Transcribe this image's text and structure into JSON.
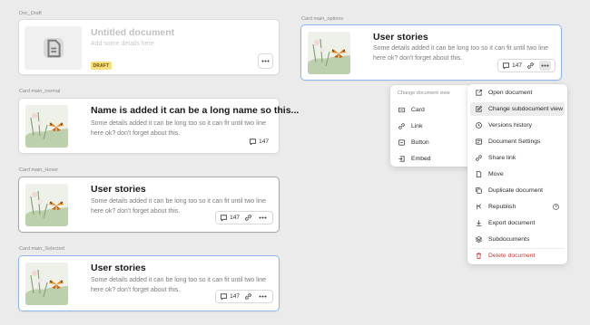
{
  "frames": {
    "doc_draft": "Doc_Draft",
    "card_main_normal": "Card main_normal",
    "card_main_hover": "Card main_Hover",
    "card_main_selected": "Card main_Selected",
    "card_main_options": "Card main_options"
  },
  "draft_card": {
    "title": "Untitled document",
    "description": "Add some details here",
    "badge": "DRAFT"
  },
  "normal_card": {
    "title": "Name is added it can be a long name so this...",
    "description": "Some details added it can be long too so it can fit until two line here ok? don't forget about this.",
    "comment_count": "147"
  },
  "hover_card": {
    "title": "User stories",
    "description": "Some details added it can be long too so it can fit until two line here ok? don't forget about this.",
    "comment_count": "147"
  },
  "selected_card": {
    "title": "User stories",
    "description": "Some details added it can be long too so it can fit until two line here ok? don't forget about this.",
    "comment_count": "147"
  },
  "options_card": {
    "title": "User stories",
    "description": "Some details added it can be long too so it can fit until two line here ok? don't forget about this.",
    "comment_count": "147"
  },
  "submenu": {
    "title": "Change document view",
    "items": [
      {
        "label": "Card",
        "icon": "card-icon"
      },
      {
        "label": "Link",
        "icon": "link-icon"
      },
      {
        "label": "Button",
        "icon": "button-icon"
      },
      {
        "label": "Embed",
        "icon": "embed-icon"
      }
    ]
  },
  "context_menu": {
    "items": [
      {
        "label": "Open document",
        "icon": "open-external-icon"
      },
      {
        "label": "Change subdocument view",
        "icon": "edit-icon",
        "highlighted": true
      },
      {
        "label": "Versions history",
        "icon": "history-icon"
      },
      {
        "label": "Document Settings",
        "icon": "settings-icon"
      },
      {
        "label": "Share link",
        "icon": "link-icon"
      },
      {
        "label": "Move",
        "icon": "move-icon"
      },
      {
        "label": "Duplicate document",
        "icon": "duplicate-icon"
      },
      {
        "label": "Republish",
        "icon": "republish-icon",
        "trailing_icon": "help-circle-icon"
      },
      {
        "label": "Export document",
        "icon": "download-icon"
      },
      {
        "label": "Subdocuments",
        "icon": "layers-icon"
      },
      {
        "label": "Delete document",
        "icon": "trash-icon",
        "danger": true
      }
    ]
  },
  "colors": {
    "selected_border": "#8fb7ef",
    "draft_badge": "#f6df7c",
    "danger": "#d23c3c"
  }
}
